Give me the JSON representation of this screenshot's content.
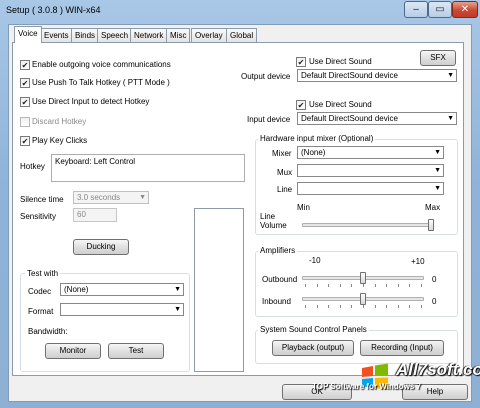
{
  "window": {
    "title": "Setup ( 3.0.8 ) WIN-x64"
  },
  "window_buttons": {
    "minimize": "–",
    "maximize": "▭",
    "close": "✕"
  },
  "tabs": [
    "Voice",
    "Events",
    "Binds",
    "Speech",
    "Network",
    "Misc",
    "Overlay",
    "Global"
  ],
  "active_tab": "Voice",
  "left": {
    "enable_outgoing": {
      "label": "Enable outgoing voice communications",
      "checked": true
    },
    "push_to_talk": {
      "label": "Use Push To Talk Hotkey ( PTT Mode )",
      "checked": true
    },
    "direct_input": {
      "label": "Use Direct Input to detect Hotkey",
      "checked": true
    },
    "discard_hotkey": {
      "label": "Discard Hotkey",
      "checked": false,
      "disabled": true
    },
    "play_key_clicks": {
      "label": "Play Key Clicks",
      "checked": true
    },
    "hotkey_label": "Hotkey",
    "hotkey_value": "Keyboard: Left Control",
    "silence_label": "Silence time",
    "silence_value": "3.0 seconds",
    "sensitivity_label": "Sensitivity",
    "sensitivity_value": "60",
    "ducking_button": "Ducking",
    "test_group": {
      "title": "Test with",
      "codec_label": "Codec",
      "codec_value": "(None)",
      "format_label": "Format",
      "format_value": "",
      "bandwidth_label": "Bandwidth:",
      "monitor_button": "Monitor",
      "test_button": "Test"
    }
  },
  "right": {
    "sfx_button": "SFX",
    "output_direct_sound": {
      "label": "Use Direct Sound",
      "checked": true
    },
    "output_device_label": "Output device",
    "output_device_value": "Default DirectSound device",
    "input_direct_sound": {
      "label": "Use Direct Sound",
      "checked": true
    },
    "input_device_label": "Input device",
    "input_device_value": "Default DirectSound device",
    "hw_mixer": {
      "title": "Hardware input mixer (Optional)",
      "mixer_label": "Mixer",
      "mixer_value": "(None)",
      "mux_label": "Mux",
      "mux_value": "",
      "line_label": "Line",
      "line_value": "",
      "min_label": "Min",
      "max_label": "Max",
      "line_volume_label": "Line Volume",
      "line_volume_level": 1.0
    },
    "amplifiers": {
      "title": "Amplifiers",
      "scale_min": "-10",
      "scale_max": "+10",
      "outbound_label": "Outbound",
      "outbound_value": "0",
      "outbound_level": 0.5,
      "inbound_label": "Inbound",
      "inbound_value": "0",
      "inbound_level": 0.5
    },
    "system_panels": {
      "title": "System Sound Control Panels",
      "playback_button": "Playback (output)",
      "recording_button": "Recording (Input)"
    }
  },
  "footer": {
    "ok_button": "OK",
    "help_button": "Help"
  },
  "watermark": {
    "brand": "All7soft.com",
    "tagline": "TOP Software for Windows 7"
  }
}
